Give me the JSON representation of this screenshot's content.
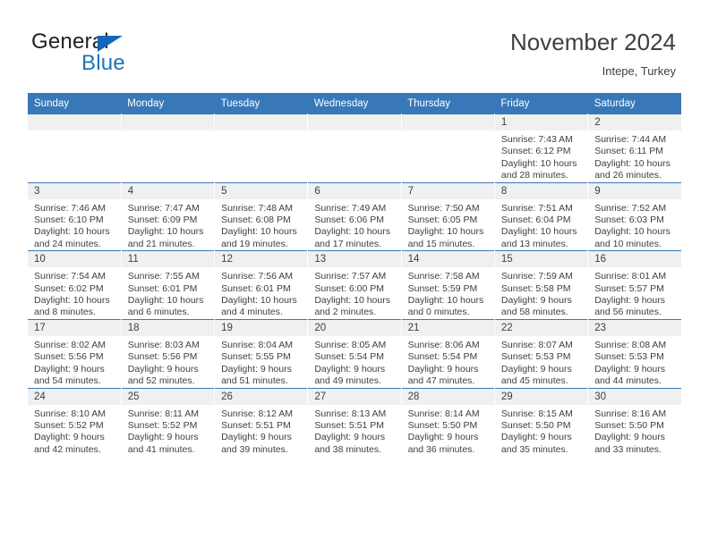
{
  "brand": {
    "name_part1": "General",
    "name_part2": "Blue",
    "accent_color": "#1b75bc",
    "header_color": "#3878b8"
  },
  "header": {
    "title": "November 2024",
    "subtitle": "Intepe, Turkey"
  },
  "weekday_headers": [
    "Sunday",
    "Monday",
    "Tuesday",
    "Wednesday",
    "Thursday",
    "Friday",
    "Saturday"
  ],
  "labels": {
    "sunrise": "Sunrise:",
    "sunset": "Sunset:",
    "daylight": "Daylight:"
  },
  "weeks": [
    [
      {
        "day": "",
        "blank": true,
        "sunrise": "",
        "sunset": "",
        "daylight_line1": "",
        "daylight_line2": ""
      },
      {
        "day": "",
        "blank": true,
        "sunrise": "",
        "sunset": "",
        "daylight_line1": "",
        "daylight_line2": ""
      },
      {
        "day": "",
        "blank": true,
        "sunrise": "",
        "sunset": "",
        "daylight_line1": "",
        "daylight_line2": ""
      },
      {
        "day": "",
        "blank": true,
        "sunrise": "",
        "sunset": "",
        "daylight_line1": "",
        "daylight_line2": ""
      },
      {
        "day": "",
        "blank": true,
        "sunrise": "",
        "sunset": "",
        "daylight_line1": "",
        "daylight_line2": ""
      },
      {
        "day": "1",
        "blank": false,
        "sunrise": "Sunrise: 7:43 AM",
        "sunset": "Sunset: 6:12 PM",
        "daylight_line1": "Daylight: 10 hours",
        "daylight_line2": "and 28 minutes."
      },
      {
        "day": "2",
        "blank": false,
        "sunrise": "Sunrise: 7:44 AM",
        "sunset": "Sunset: 6:11 PM",
        "daylight_line1": "Daylight: 10 hours",
        "daylight_line2": "and 26 minutes."
      }
    ],
    [
      {
        "day": "3",
        "blank": false,
        "sunrise": "Sunrise: 7:46 AM",
        "sunset": "Sunset: 6:10 PM",
        "daylight_line1": "Daylight: 10 hours",
        "daylight_line2": "and 24 minutes."
      },
      {
        "day": "4",
        "blank": false,
        "sunrise": "Sunrise: 7:47 AM",
        "sunset": "Sunset: 6:09 PM",
        "daylight_line1": "Daylight: 10 hours",
        "daylight_line2": "and 21 minutes."
      },
      {
        "day": "5",
        "blank": false,
        "sunrise": "Sunrise: 7:48 AM",
        "sunset": "Sunset: 6:08 PM",
        "daylight_line1": "Daylight: 10 hours",
        "daylight_line2": "and 19 minutes."
      },
      {
        "day": "6",
        "blank": false,
        "sunrise": "Sunrise: 7:49 AM",
        "sunset": "Sunset: 6:06 PM",
        "daylight_line1": "Daylight: 10 hours",
        "daylight_line2": "and 17 minutes."
      },
      {
        "day": "7",
        "blank": false,
        "sunrise": "Sunrise: 7:50 AM",
        "sunset": "Sunset: 6:05 PM",
        "daylight_line1": "Daylight: 10 hours",
        "daylight_line2": "and 15 minutes."
      },
      {
        "day": "8",
        "blank": false,
        "sunrise": "Sunrise: 7:51 AM",
        "sunset": "Sunset: 6:04 PM",
        "daylight_line1": "Daylight: 10 hours",
        "daylight_line2": "and 13 minutes."
      },
      {
        "day": "9",
        "blank": false,
        "sunrise": "Sunrise: 7:52 AM",
        "sunset": "Sunset: 6:03 PM",
        "daylight_line1": "Daylight: 10 hours",
        "daylight_line2": "and 10 minutes."
      }
    ],
    [
      {
        "day": "10",
        "blank": false,
        "sunrise": "Sunrise: 7:54 AM",
        "sunset": "Sunset: 6:02 PM",
        "daylight_line1": "Daylight: 10 hours",
        "daylight_line2": "and 8 minutes."
      },
      {
        "day": "11",
        "blank": false,
        "sunrise": "Sunrise: 7:55 AM",
        "sunset": "Sunset: 6:01 PM",
        "daylight_line1": "Daylight: 10 hours",
        "daylight_line2": "and 6 minutes."
      },
      {
        "day": "12",
        "blank": false,
        "sunrise": "Sunrise: 7:56 AM",
        "sunset": "Sunset: 6:01 PM",
        "daylight_line1": "Daylight: 10 hours",
        "daylight_line2": "and 4 minutes."
      },
      {
        "day": "13",
        "blank": false,
        "sunrise": "Sunrise: 7:57 AM",
        "sunset": "Sunset: 6:00 PM",
        "daylight_line1": "Daylight: 10 hours",
        "daylight_line2": "and 2 minutes."
      },
      {
        "day": "14",
        "blank": false,
        "sunrise": "Sunrise: 7:58 AM",
        "sunset": "Sunset: 5:59 PM",
        "daylight_line1": "Daylight: 10 hours",
        "daylight_line2": "and 0 minutes."
      },
      {
        "day": "15",
        "blank": false,
        "sunrise": "Sunrise: 7:59 AM",
        "sunset": "Sunset: 5:58 PM",
        "daylight_line1": "Daylight: 9 hours",
        "daylight_line2": "and 58 minutes."
      },
      {
        "day": "16",
        "blank": false,
        "sunrise": "Sunrise: 8:01 AM",
        "sunset": "Sunset: 5:57 PM",
        "daylight_line1": "Daylight: 9 hours",
        "daylight_line2": "and 56 minutes."
      }
    ],
    [
      {
        "day": "17",
        "blank": false,
        "sunrise": "Sunrise: 8:02 AM",
        "sunset": "Sunset: 5:56 PM",
        "daylight_line1": "Daylight: 9 hours",
        "daylight_line2": "and 54 minutes."
      },
      {
        "day": "18",
        "blank": false,
        "sunrise": "Sunrise: 8:03 AM",
        "sunset": "Sunset: 5:56 PM",
        "daylight_line1": "Daylight: 9 hours",
        "daylight_line2": "and 52 minutes."
      },
      {
        "day": "19",
        "blank": false,
        "sunrise": "Sunrise: 8:04 AM",
        "sunset": "Sunset: 5:55 PM",
        "daylight_line1": "Daylight: 9 hours",
        "daylight_line2": "and 51 minutes."
      },
      {
        "day": "20",
        "blank": false,
        "sunrise": "Sunrise: 8:05 AM",
        "sunset": "Sunset: 5:54 PM",
        "daylight_line1": "Daylight: 9 hours",
        "daylight_line2": "and 49 minutes."
      },
      {
        "day": "21",
        "blank": false,
        "sunrise": "Sunrise: 8:06 AM",
        "sunset": "Sunset: 5:54 PM",
        "daylight_line1": "Daylight: 9 hours",
        "daylight_line2": "and 47 minutes."
      },
      {
        "day": "22",
        "blank": false,
        "sunrise": "Sunrise: 8:07 AM",
        "sunset": "Sunset: 5:53 PM",
        "daylight_line1": "Daylight: 9 hours",
        "daylight_line2": "and 45 minutes."
      },
      {
        "day": "23",
        "blank": false,
        "sunrise": "Sunrise: 8:08 AM",
        "sunset": "Sunset: 5:53 PM",
        "daylight_line1": "Daylight: 9 hours",
        "daylight_line2": "and 44 minutes."
      }
    ],
    [
      {
        "day": "24",
        "blank": false,
        "sunrise": "Sunrise: 8:10 AM",
        "sunset": "Sunset: 5:52 PM",
        "daylight_line1": "Daylight: 9 hours",
        "daylight_line2": "and 42 minutes."
      },
      {
        "day": "25",
        "blank": false,
        "sunrise": "Sunrise: 8:11 AM",
        "sunset": "Sunset: 5:52 PM",
        "daylight_line1": "Daylight: 9 hours",
        "daylight_line2": "and 41 minutes."
      },
      {
        "day": "26",
        "blank": false,
        "sunrise": "Sunrise: 8:12 AM",
        "sunset": "Sunset: 5:51 PM",
        "daylight_line1": "Daylight: 9 hours",
        "daylight_line2": "and 39 minutes."
      },
      {
        "day": "27",
        "blank": false,
        "sunrise": "Sunrise: 8:13 AM",
        "sunset": "Sunset: 5:51 PM",
        "daylight_line1": "Daylight: 9 hours",
        "daylight_line2": "and 38 minutes."
      },
      {
        "day": "28",
        "blank": false,
        "sunrise": "Sunrise: 8:14 AM",
        "sunset": "Sunset: 5:50 PM",
        "daylight_line1": "Daylight: 9 hours",
        "daylight_line2": "and 36 minutes."
      },
      {
        "day": "29",
        "blank": false,
        "sunrise": "Sunrise: 8:15 AM",
        "sunset": "Sunset: 5:50 PM",
        "daylight_line1": "Daylight: 9 hours",
        "daylight_line2": "and 35 minutes."
      },
      {
        "day": "30",
        "blank": false,
        "sunrise": "Sunrise: 8:16 AM",
        "sunset": "Sunset: 5:50 PM",
        "daylight_line1": "Daylight: 9 hours",
        "daylight_line2": "and 33 minutes."
      }
    ]
  ]
}
